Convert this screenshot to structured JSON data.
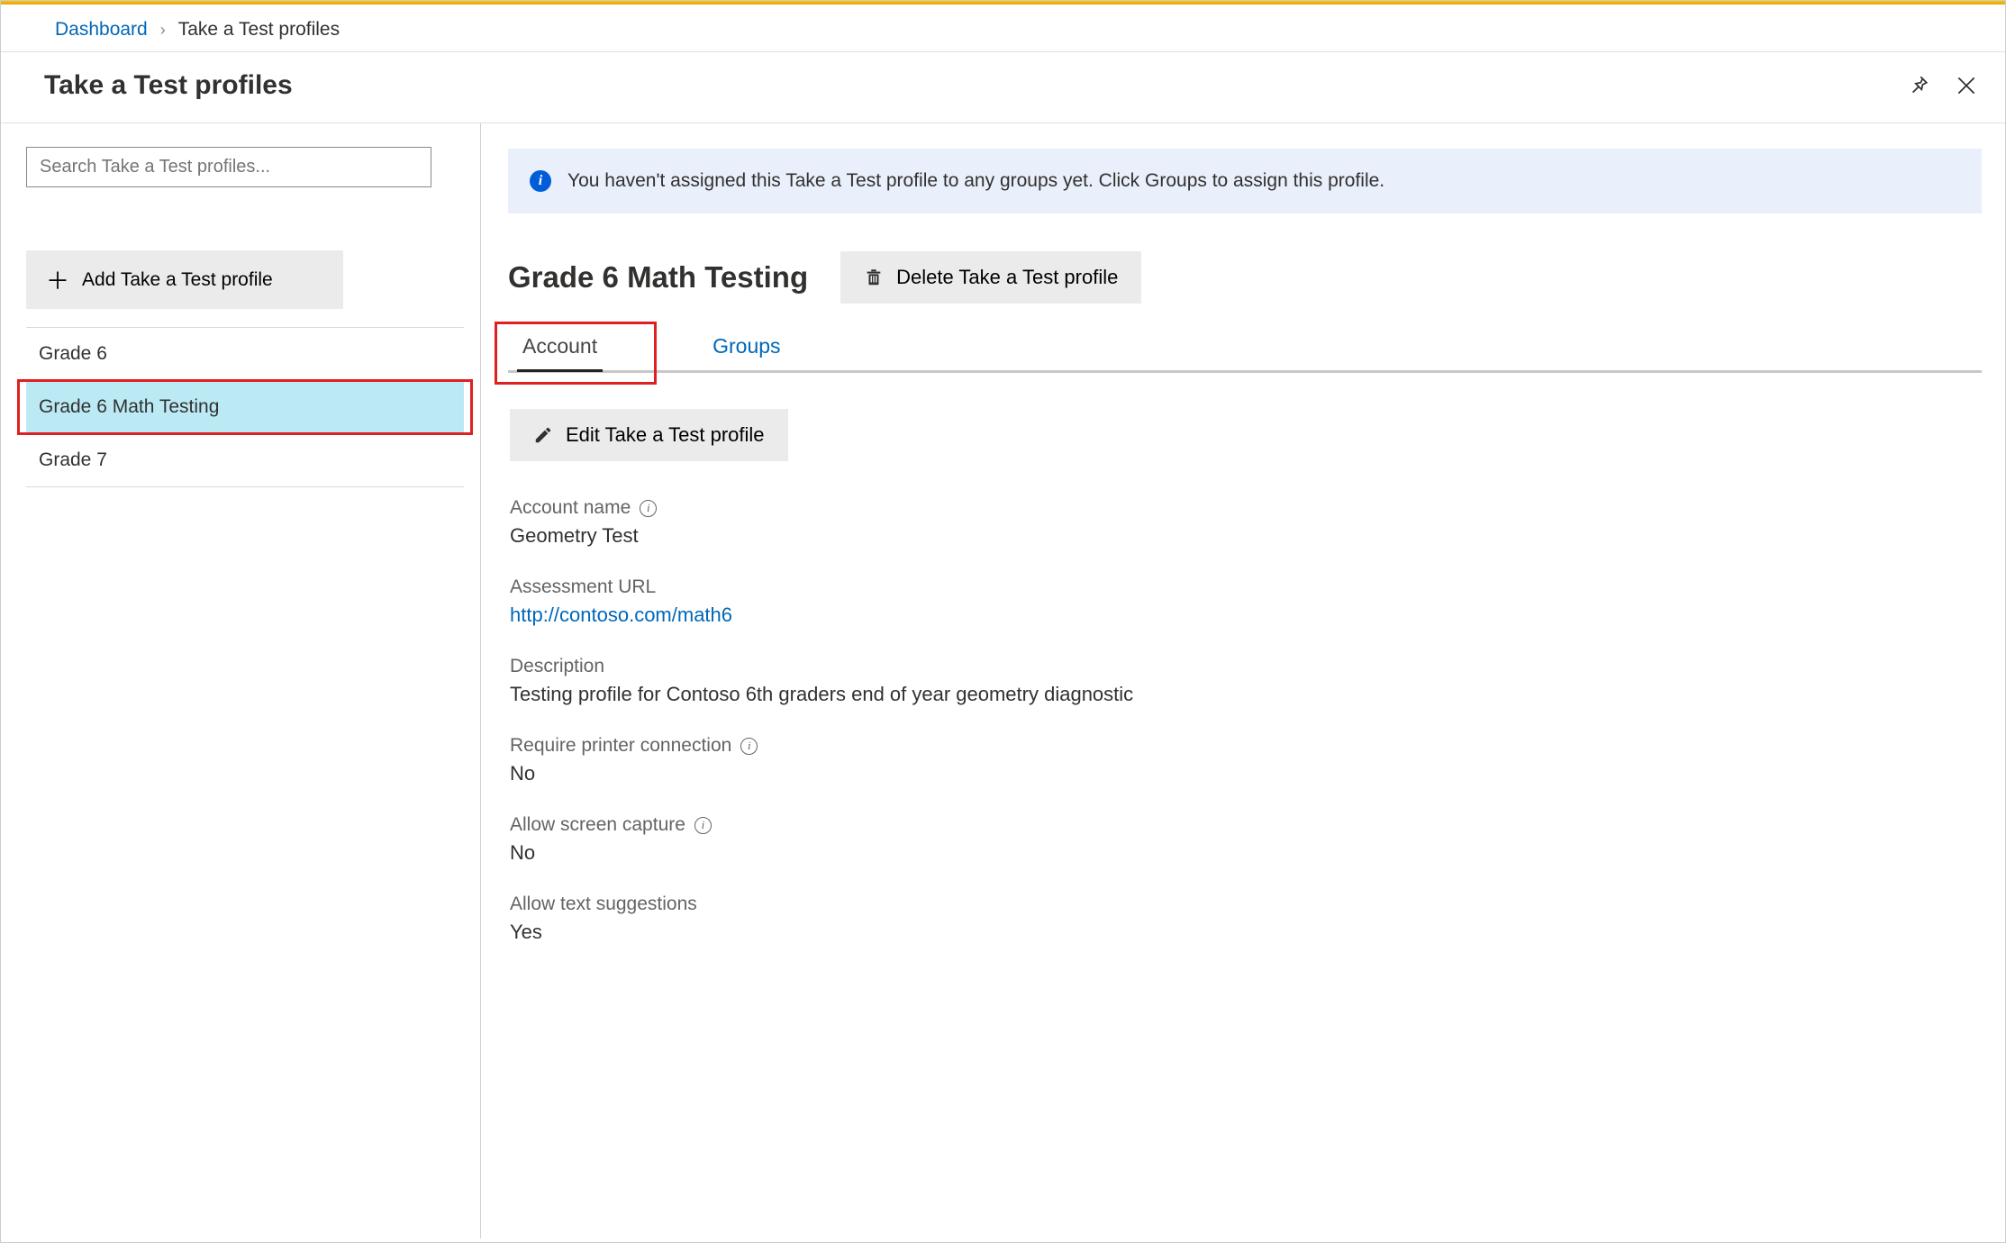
{
  "breadcrumb": {
    "root": "Dashboard",
    "current": "Take a Test profiles"
  },
  "page_title": "Take a Test profiles",
  "sidebar": {
    "search_placeholder": "Search Take a Test profiles...",
    "add_label": "Add Take a Test profile",
    "items": [
      {
        "label": "Grade 6",
        "selected": false
      },
      {
        "label": "Grade 6 Math Testing",
        "selected": true
      },
      {
        "label": "Grade 7",
        "selected": false
      }
    ]
  },
  "banner": {
    "text": "You haven't assigned this Take a Test profile to any groups yet. Click Groups to assign this profile."
  },
  "detail": {
    "title": "Grade 6 Math Testing",
    "delete_label": "Delete Take a Test profile",
    "tabs": [
      {
        "label": "Account",
        "active": true
      },
      {
        "label": "Groups",
        "active": false
      }
    ],
    "edit_label": "Edit Take a Test profile",
    "fields": {
      "account_name_label": "Account name",
      "account_name_value": "Geometry Test",
      "assessment_url_label": "Assessment URL",
      "assessment_url_value": "http://contoso.com/math6",
      "description_label": "Description",
      "description_value": "Testing profile for Contoso 6th graders end of year geometry diagnostic",
      "printer_label": "Require printer connection",
      "printer_value": "No",
      "screen_label": "Allow screen capture",
      "screen_value": "No",
      "text_label": "Allow text suggestions",
      "text_value": "Yes"
    }
  }
}
